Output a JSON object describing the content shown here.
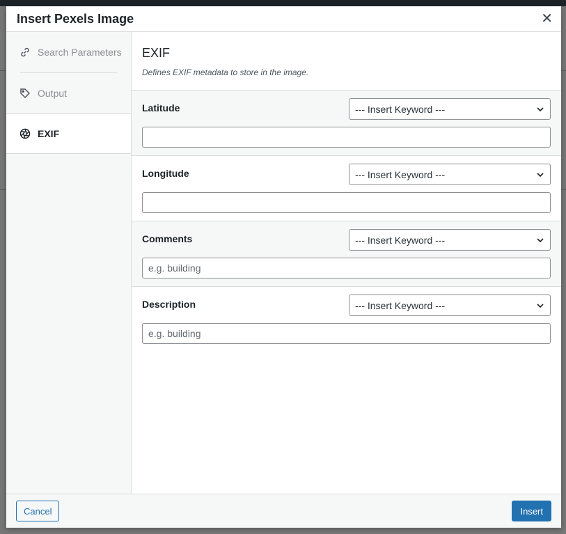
{
  "modal": {
    "title": "Insert Pexels Image",
    "close_icon": "close-icon"
  },
  "sidebar": {
    "items": [
      {
        "label": "Search Parameters",
        "icon": "link-icon",
        "active": false
      },
      {
        "label": "Output",
        "icon": "tag-icon",
        "active": false
      },
      {
        "label": "EXIF",
        "icon": "aperture-icon",
        "active": true
      }
    ]
  },
  "section": {
    "title": "EXIF",
    "description": "Defines EXIF metadata to store in the image."
  },
  "fields": [
    {
      "label": "Latitude",
      "select_value": "--- Insert Keyword ---",
      "input_value": "",
      "placeholder": ""
    },
    {
      "label": "Longitude",
      "select_value": "--- Insert Keyword ---",
      "input_value": "",
      "placeholder": ""
    },
    {
      "label": "Comments",
      "select_value": "--- Insert Keyword ---",
      "input_value": "",
      "placeholder": "e.g. building"
    },
    {
      "label": "Description",
      "select_value": "--- Insert Keyword ---",
      "input_value": "",
      "placeholder": "e.g. building"
    }
  ],
  "footer": {
    "cancel_label": "Cancel",
    "insert_label": "Insert"
  },
  "colors": {
    "accent": "#2271b1",
    "sidebar_bg": "#f6f7f7",
    "border": "#dcdcde"
  }
}
